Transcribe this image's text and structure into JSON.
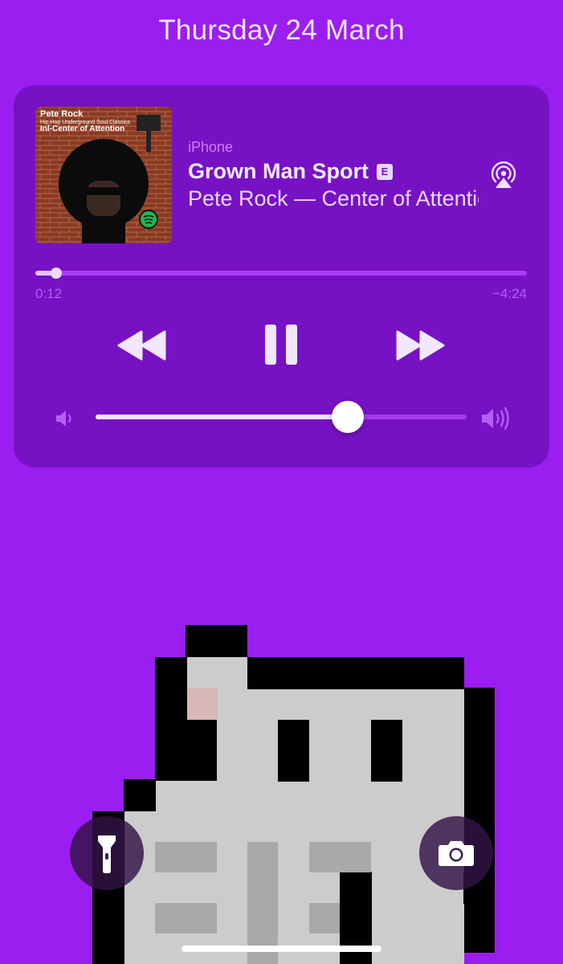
{
  "lockscreen": {
    "date": "Thursday 24 March"
  },
  "now_playing": {
    "artwork": {
      "artist": "Pete Rock",
      "subtitle": "Hip Hop Underground Soul Classics",
      "title": "Inl-Center of Attention"
    },
    "device": "iPhone",
    "title": "Grown Man Sport",
    "explicit_badge": "E",
    "subtitle": "Pete Rock — Center of Attention",
    "elapsed": "0:12",
    "remaining": "−4:24",
    "progress_fraction": 0.043,
    "volume_fraction": 0.68,
    "icons": [
      "airplay-icon",
      "rewind-icon",
      "pause-icon",
      "fast-forward-icon",
      "volume-low-icon",
      "volume-high-icon"
    ]
  },
  "quick_actions": {
    "icons": [
      "flashlight-icon",
      "camera-icon"
    ]
  },
  "colors": {
    "background": "#9b1ef0",
    "player_background": "#7612c4",
    "accent_text": "#d17af7",
    "wallpaper_black": "#000000",
    "wallpaper_gray": "#cccccc"
  }
}
